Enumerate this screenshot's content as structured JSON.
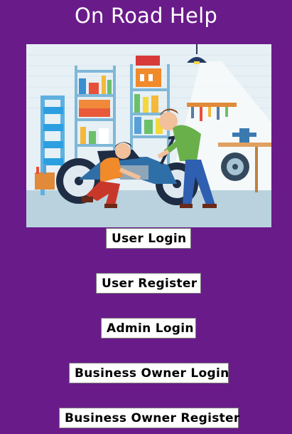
{
  "header": {
    "title": "On Road Help"
  },
  "hero": {
    "icon": "mechanics-repairing-motorcycle-illustration"
  },
  "buttons": {
    "user_login": "User Login",
    "user_register": "User Register",
    "admin_login": "Admin Login",
    "business_owner_login": "Business Owner Login",
    "business_owner_register": "Business Owner Register"
  },
  "colors": {
    "background": "#6a1b8a",
    "button_background": "#ffffff",
    "title_text": "#ffffff"
  }
}
